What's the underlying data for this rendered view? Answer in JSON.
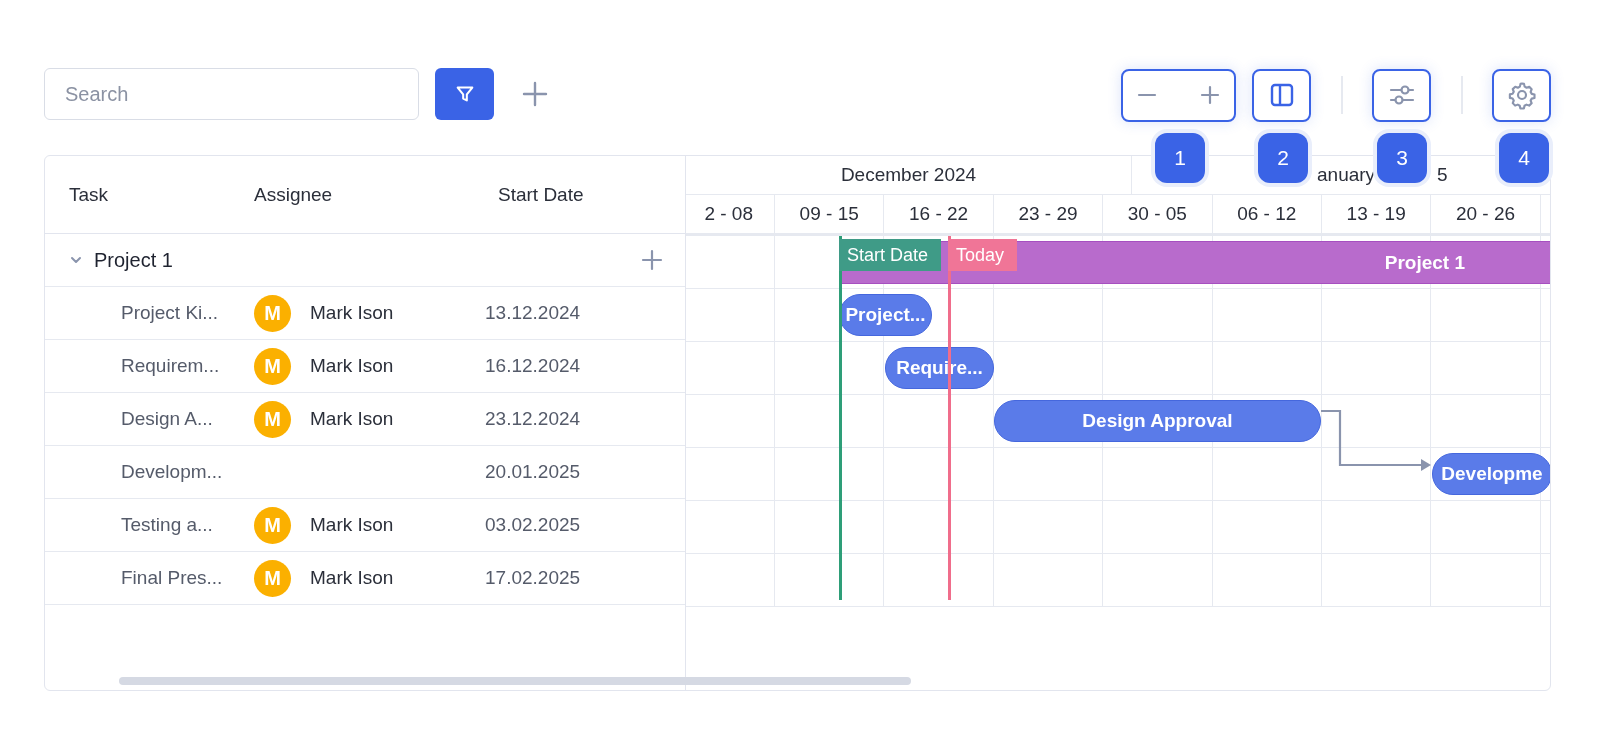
{
  "toolbar": {
    "search": {
      "placeholder": "Search"
    }
  },
  "badges": [
    "1",
    "2",
    "3",
    "4"
  ],
  "grid": {
    "columns": [
      "Task",
      "Assignee",
      "Start Date"
    ],
    "rows": [
      {
        "kind": "group",
        "task": "Project 1",
        "expanded": true
      },
      {
        "kind": "task",
        "task": "Project Ki...",
        "initial": "M",
        "assignee": "Mark Ison",
        "start": "13.12.2024"
      },
      {
        "kind": "task",
        "task": "Requirem...",
        "initial": "M",
        "assignee": "Mark Ison",
        "start": "16.12.2024"
      },
      {
        "kind": "task",
        "task": "Design A...",
        "initial": "M",
        "assignee": "Mark Ison",
        "start": "23.12.2024"
      },
      {
        "kind": "task",
        "task": "Developm...",
        "start": "20.01.2025"
      },
      {
        "kind": "task",
        "task": "Testing a...",
        "initial": "M",
        "assignee": "Mark Ison",
        "start": "03.02.2025"
      },
      {
        "kind": "task",
        "task": "Final Pres...",
        "initial": "M",
        "assignee": "Mark Ison",
        "start": "17.02.2025"
      }
    ]
  },
  "timeline": {
    "months": [
      {
        "label": "December 2024"
      },
      {
        "label": "anuary",
        "tail": "5"
      }
    ],
    "weeks": [
      "2 - 08",
      "09 - 15",
      "16 - 22",
      "23 - 29",
      "30 - 05",
      "06 - 12",
      "13 - 19",
      "20 - 26"
    ],
    "markers": [
      {
        "kind": "start",
        "label": "Start Date"
      },
      {
        "kind": "today",
        "label": "Today"
      }
    ],
    "bars": [
      {
        "kind": "project",
        "label": "Project 1"
      },
      {
        "kind": "task",
        "label": "Project..."
      },
      {
        "kind": "task",
        "label": "Require..."
      },
      {
        "kind": "task",
        "label": "Design Approval"
      },
      {
        "kind": "task",
        "label": "Developme"
      }
    ]
  }
}
